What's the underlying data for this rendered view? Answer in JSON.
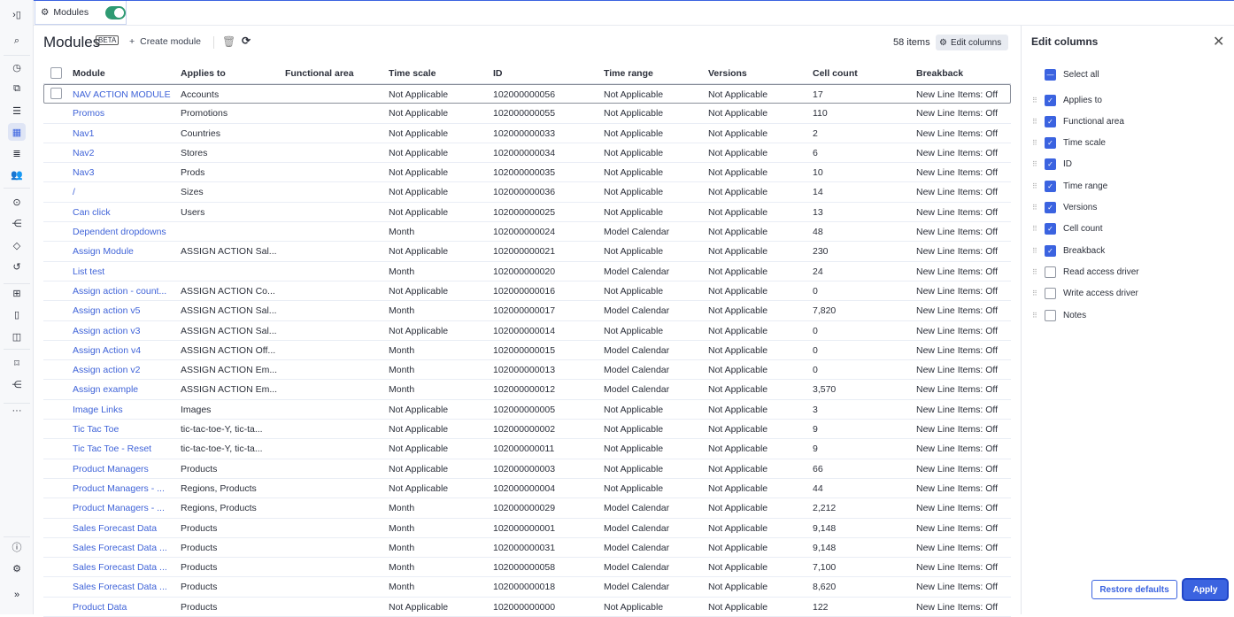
{
  "tab": {
    "label": "Modules",
    "toggle_on": true
  },
  "header": {
    "title": "Modules",
    "badge": "BETA",
    "create_label": "Create module",
    "item_count": "58 items",
    "edit_columns_label": "Edit columns"
  },
  "table": {
    "columns": [
      "Module",
      "Applies to",
      "Functional area",
      "Time scale",
      "ID",
      "Time range",
      "Versions",
      "Cell count",
      "Breakback"
    ],
    "rows": [
      [
        "NAV ACTION MODULE",
        "Accounts",
        "",
        "Not Applicable",
        "102000000056",
        "Not Applicable",
        "Not Applicable",
        "17",
        "New Line Items: Off"
      ],
      [
        "Promos",
        "Promotions",
        "",
        "Not Applicable",
        "102000000055",
        "Not Applicable",
        "Not Applicable",
        "110",
        "New Line Items: Off"
      ],
      [
        "Nav1",
        "Countries",
        "",
        "Not Applicable",
        "102000000033",
        "Not Applicable",
        "Not Applicable",
        "2",
        "New Line Items: Off"
      ],
      [
        "Nav2",
        "Stores",
        "",
        "Not Applicable",
        "102000000034",
        "Not Applicable",
        "Not Applicable",
        "6",
        "New Line Items: Off"
      ],
      [
        "Nav3",
        "Prods",
        "",
        "Not Applicable",
        "102000000035",
        "Not Applicable",
        "Not Applicable",
        "10",
        "New Line Items: Off"
      ],
      [
        "/",
        "Sizes",
        "",
        "Not Applicable",
        "102000000036",
        "Not Applicable",
        "Not Applicable",
        "14",
        "New Line Items: Off"
      ],
      [
        "Can click",
        "Users",
        "",
        "Not Applicable",
        "102000000025",
        "Not Applicable",
        "Not Applicable",
        "13",
        "New Line Items: Off"
      ],
      [
        "Dependent dropdowns",
        "",
        "",
        "Month",
        "102000000024",
        "Model Calendar",
        "Not Applicable",
        "48",
        "New Line Items: Off"
      ],
      [
        "Assign Module",
        "ASSIGN ACTION Sal...",
        "",
        "Not Applicable",
        "102000000021",
        "Not Applicable",
        "Not Applicable",
        "230",
        "New Line Items: Off"
      ],
      [
        "List test",
        "",
        "",
        "Month",
        "102000000020",
        "Model Calendar",
        "Not Applicable",
        "24",
        "New Line Items: Off"
      ],
      [
        "Assign action - count...",
        "ASSIGN ACTION Co...",
        "",
        "Not Applicable",
        "102000000016",
        "Not Applicable",
        "Not Applicable",
        "0",
        "New Line Items: Off"
      ],
      [
        "Assign action v5",
        "ASSIGN ACTION Sal...",
        "",
        "Month",
        "102000000017",
        "Model Calendar",
        "Not Applicable",
        "7,820",
        "New Line Items: Off"
      ],
      [
        "Assign action v3",
        "ASSIGN ACTION Sal...",
        "",
        "Not Applicable",
        "102000000014",
        "Not Applicable",
        "Not Applicable",
        "0",
        "New Line Items: Off"
      ],
      [
        "Assign Action v4",
        "ASSIGN ACTION Off...",
        "",
        "Month",
        "102000000015",
        "Model Calendar",
        "Not Applicable",
        "0",
        "New Line Items: Off"
      ],
      [
        "Assign action v2",
        "ASSIGN ACTION Em...",
        "",
        "Month",
        "102000000013",
        "Model Calendar",
        "Not Applicable",
        "0",
        "New Line Items: Off"
      ],
      [
        "Assign example",
        "ASSIGN ACTION Em...",
        "",
        "Month",
        "102000000012",
        "Model Calendar",
        "Not Applicable",
        "3,570",
        "New Line Items: Off"
      ],
      [
        "Image Links",
        "Images",
        "",
        "Not Applicable",
        "102000000005",
        "Not Applicable",
        "Not Applicable",
        "3",
        "New Line Items: Off"
      ],
      [
        "Tic Tac Toe",
        "tic-tac-toe-Y, tic-ta...",
        "",
        "Not Applicable",
        "102000000002",
        "Not Applicable",
        "Not Applicable",
        "9",
        "New Line Items: Off"
      ],
      [
        "Tic Tac Toe - Reset",
        "tic-tac-toe-Y, tic-ta...",
        "",
        "Not Applicable",
        "102000000011",
        "Not Applicable",
        "Not Applicable",
        "9",
        "New Line Items: Off"
      ],
      [
        "Product Managers",
        "Products",
        "",
        "Not Applicable",
        "102000000003",
        "Not Applicable",
        "Not Applicable",
        "66",
        "New Line Items: Off"
      ],
      [
        "Product Managers - ...",
        "Regions, Products",
        "",
        "Not Applicable",
        "102000000004",
        "Not Applicable",
        "Not Applicable",
        "44",
        "New Line Items: Off"
      ],
      [
        "Product Managers - ...",
        "Regions, Products",
        "",
        "Month",
        "102000000029",
        "Model Calendar",
        "Not Applicable",
        "2,212",
        "New Line Items: Off"
      ],
      [
        "Sales Forecast Data",
        "Products",
        "",
        "Month",
        "102000000001",
        "Model Calendar",
        "Not Applicable",
        "9,148",
        "New Line Items: Off"
      ],
      [
        "Sales Forecast Data ...",
        "Products",
        "",
        "Month",
        "102000000031",
        "Model Calendar",
        "Not Applicable",
        "9,148",
        "New Line Items: Off"
      ],
      [
        "Sales Forecast Data ...",
        "Products",
        "",
        "Month",
        "102000000058",
        "Model Calendar",
        "Not Applicable",
        "7,100",
        "New Line Items: Off"
      ],
      [
        "Sales Forecast Data ...",
        "Products",
        "",
        "Month",
        "102000000018",
        "Model Calendar",
        "Not Applicable",
        "8,620",
        "New Line Items: Off"
      ],
      [
        "Product Data",
        "Products",
        "",
        "Not Applicable",
        "102000000000",
        "Not Applicable",
        "Not Applicable",
        "122",
        "New Line Items: Off"
      ]
    ]
  },
  "panel": {
    "title": "Edit columns",
    "select_all": "Select all",
    "items": [
      {
        "label": "Applies to",
        "checked": true
      },
      {
        "label": "Functional area",
        "checked": true
      },
      {
        "label": "Time scale",
        "checked": true
      },
      {
        "label": "ID",
        "checked": true
      },
      {
        "label": "Time range",
        "checked": true
      },
      {
        "label": "Versions",
        "checked": true
      },
      {
        "label": "Cell count",
        "checked": true
      },
      {
        "label": "Breakback",
        "checked": true
      },
      {
        "label": "Read access driver",
        "checked": false
      },
      {
        "label": "Write access driver",
        "checked": false
      },
      {
        "label": "Notes",
        "checked": false
      }
    ],
    "restore_label": "Restore defaults",
    "apply_label": "Apply"
  },
  "sidebar": {
    "icons": [
      "expand-panel-icon",
      "search-icon",
      "recent-icon",
      "pages-icon",
      "list-icon",
      "modules-icon",
      "line-items-icon",
      "users-icon",
      "actions-icon",
      "processes-icon",
      "tags-icon",
      "history-icon",
      "grid-icon",
      "page-icon",
      "layout-icon",
      "bookmark-icon",
      "hierarchy-icon",
      "more-icon",
      "info-icon",
      "settings-icon",
      "collapse-icon"
    ]
  },
  "colors": {
    "accent": "#3b63e0",
    "link": "#3f63d8",
    "toggle": "#2e9a72"
  }
}
